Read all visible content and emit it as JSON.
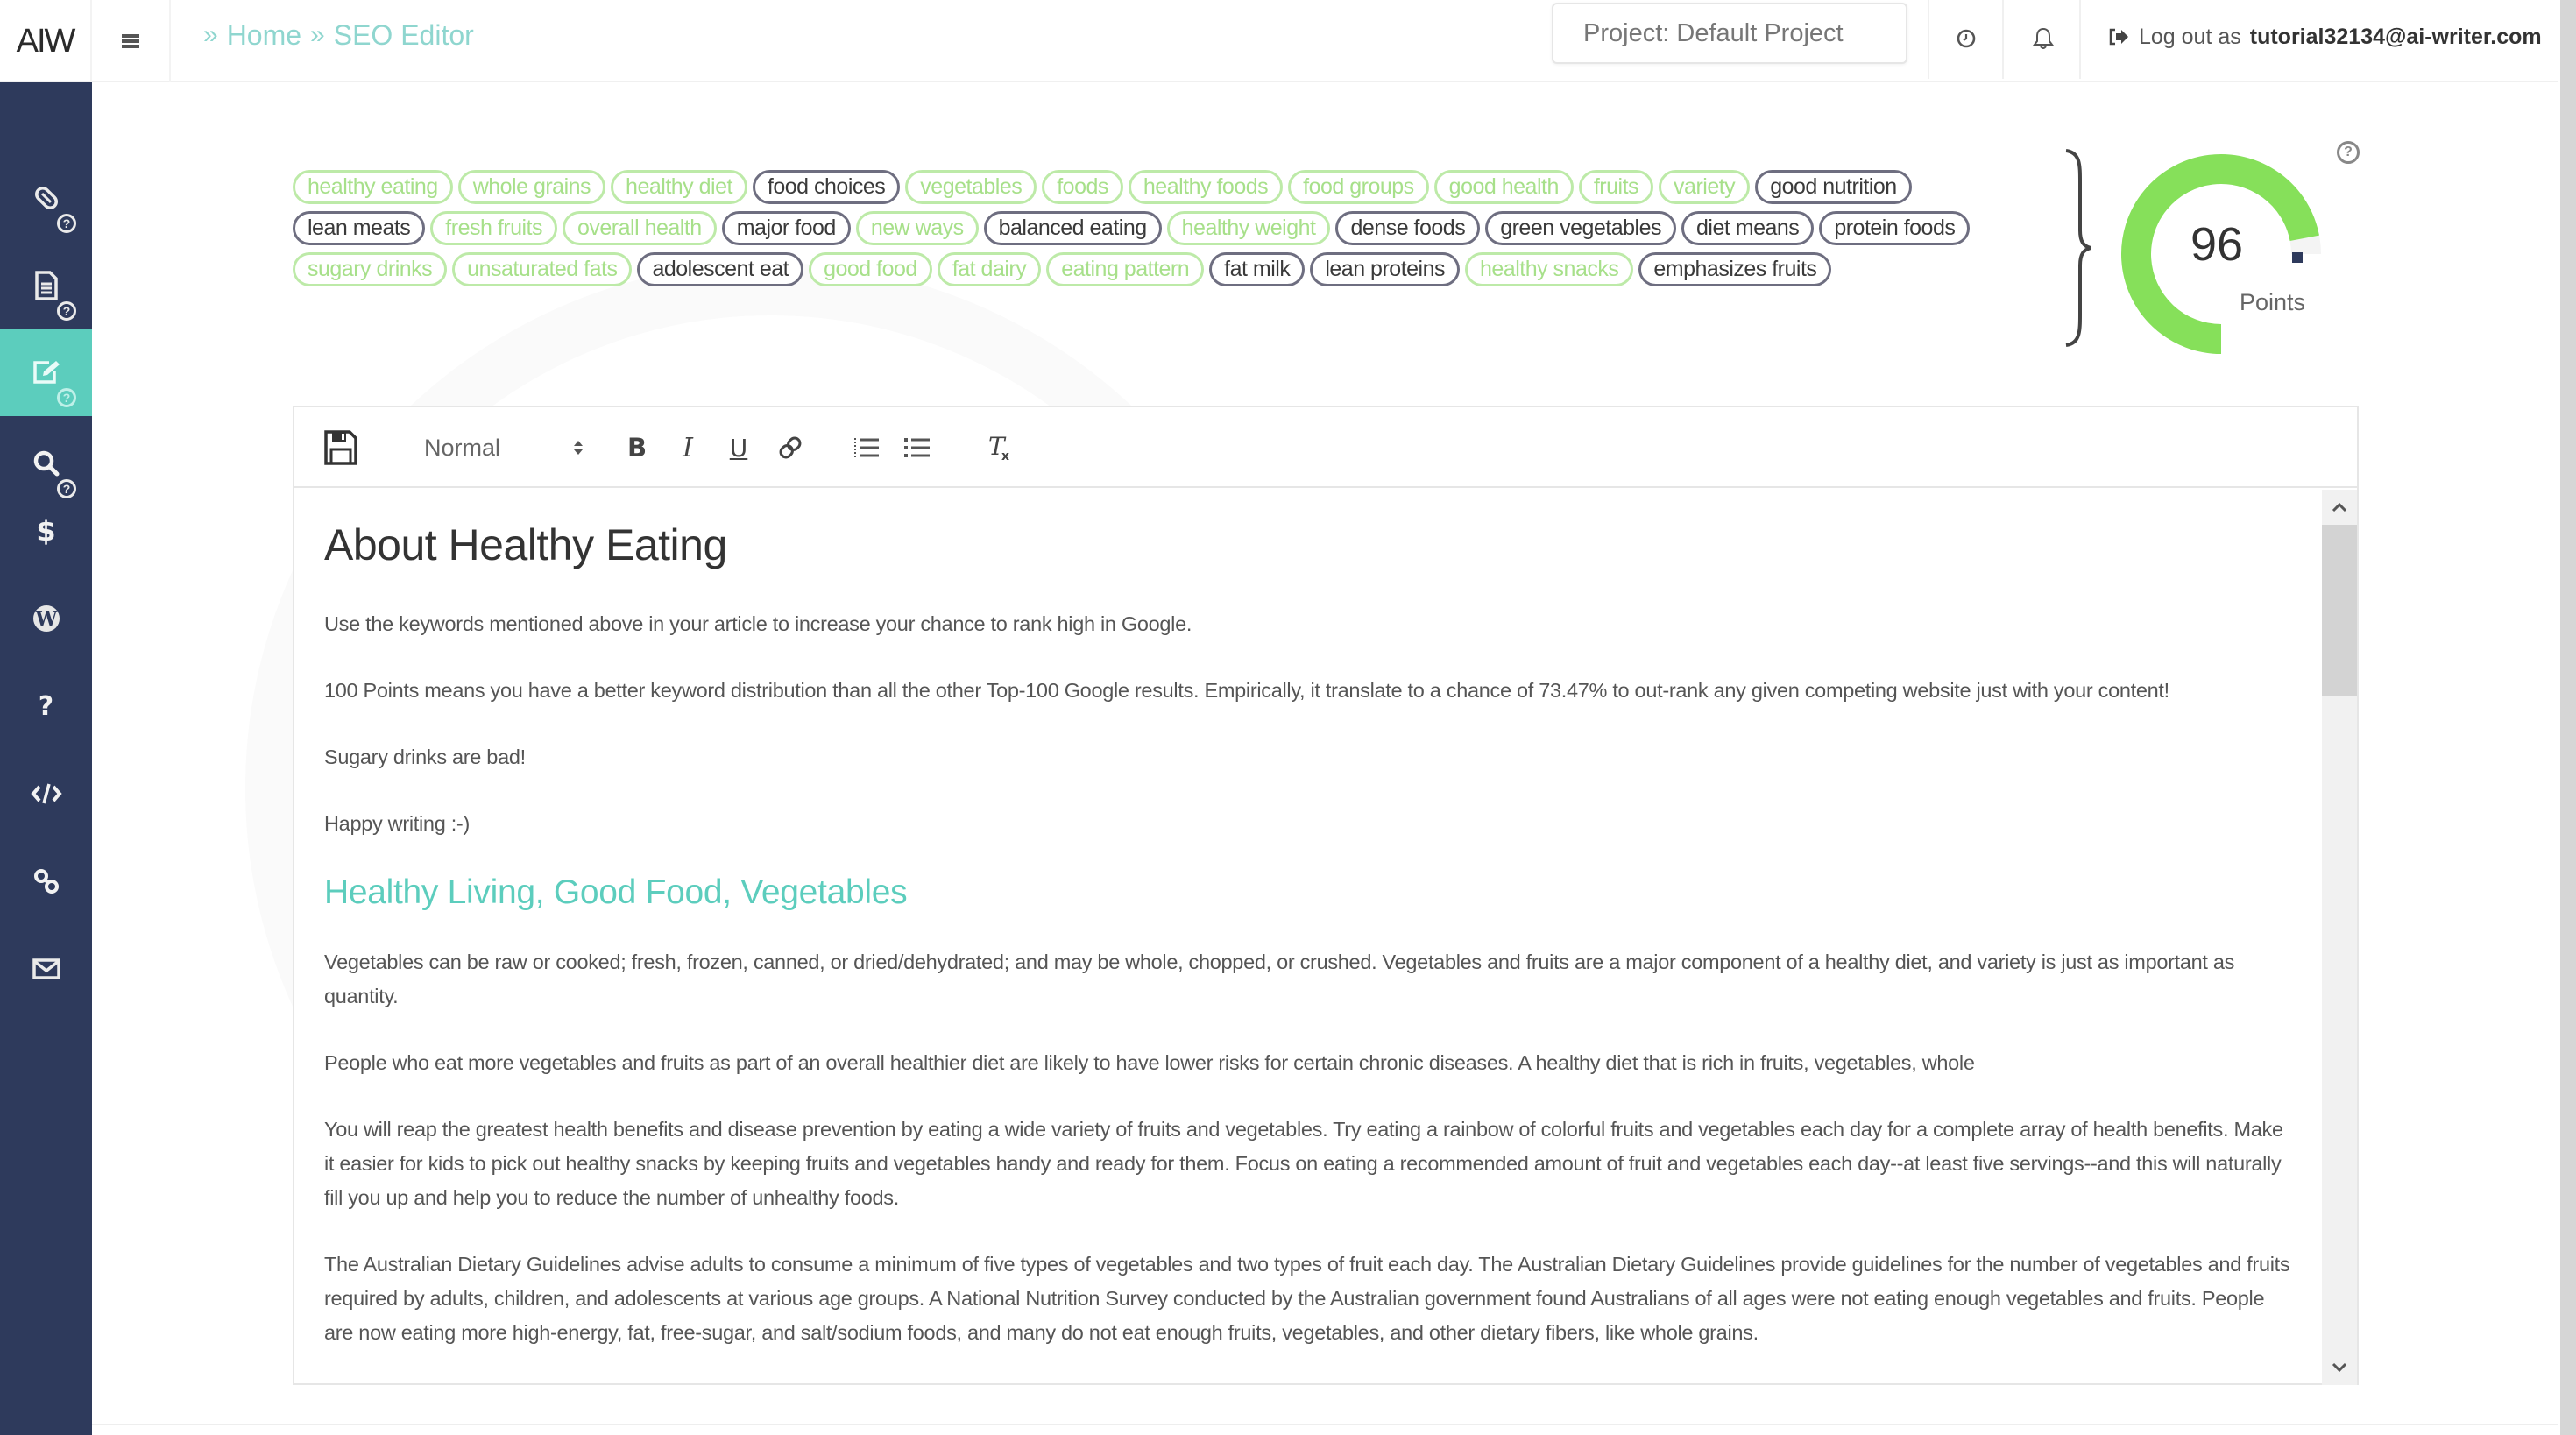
{
  "app": {
    "logo": "AIW",
    "breadcrumb": [
      {
        "label": "Home"
      },
      {
        "label": "SEO Editor"
      }
    ],
    "breadcrumb_separator": "»",
    "project_selector": "Project: Default Project",
    "logout_prefix": "Log out as",
    "user_email": "tutorial32134@ai-writer.com"
  },
  "sidebar": {
    "items": [
      {
        "icon": "paperclip-icon",
        "has_help": true,
        "active": false
      },
      {
        "icon": "document-icon",
        "has_help": true,
        "active": false
      },
      {
        "icon": "edit-icon",
        "has_help": true,
        "active": true
      },
      {
        "icon": "search-icon",
        "has_help": true,
        "active": false
      },
      {
        "icon": "dollar-icon",
        "has_help": false,
        "active": false
      },
      {
        "icon": "wordpress-icon",
        "has_help": false,
        "active": false
      },
      {
        "icon": "question-icon",
        "has_help": false,
        "active": false
      },
      {
        "icon": "code-icon",
        "has_help": false,
        "active": false
      },
      {
        "icon": "link-icon",
        "has_help": false,
        "active": false
      },
      {
        "icon": "envelope-icon",
        "has_help": false,
        "active": false
      }
    ],
    "help_glyph": "?"
  },
  "keywords": [
    {
      "text": "healthy eating",
      "used": false
    },
    {
      "text": "whole grains",
      "used": false
    },
    {
      "text": "healthy diet",
      "used": false
    },
    {
      "text": "food choices",
      "used": true
    },
    {
      "text": "vegetables",
      "used": false
    },
    {
      "text": "foods",
      "used": false
    },
    {
      "text": "healthy foods",
      "used": false
    },
    {
      "text": "food groups",
      "used": false
    },
    {
      "text": "good health",
      "used": false
    },
    {
      "text": "fruits",
      "used": false
    },
    {
      "text": "variety",
      "used": false
    },
    {
      "text": "good nutrition",
      "used": true
    },
    {
      "text": "lean meats",
      "used": true
    },
    {
      "text": "fresh fruits",
      "used": false
    },
    {
      "text": "overall health",
      "used": false
    },
    {
      "text": "major food",
      "used": true
    },
    {
      "text": "new ways",
      "used": false
    },
    {
      "text": "balanced eating",
      "used": true
    },
    {
      "text": "healthy weight",
      "used": false
    },
    {
      "text": "dense foods",
      "used": true
    },
    {
      "text": "green vegetables",
      "used": true
    },
    {
      "text": "diet means",
      "used": true
    },
    {
      "text": "protein foods",
      "used": true
    },
    {
      "text": "sugary drinks",
      "used": false
    },
    {
      "text": "unsaturated fats",
      "used": false
    },
    {
      "text": "adolescent eat",
      "used": true
    },
    {
      "text": "good food",
      "used": false
    },
    {
      "text": "fat dairy",
      "used": false
    },
    {
      "text": "eating pattern",
      "used": false
    },
    {
      "text": "fat milk",
      "used": true
    },
    {
      "text": "lean proteins",
      "used": true
    },
    {
      "text": "healthy snacks",
      "used": false
    },
    {
      "text": "emphasizes fruits",
      "used": true
    }
  ],
  "score": {
    "value": 96,
    "max": 100,
    "label": "Points",
    "help_glyph": "?",
    "color": "#86e05a",
    "marker_color": "#2e3a5c"
  },
  "editor": {
    "toolbar": {
      "format_select": "Normal",
      "buttons": [
        "save",
        "bold",
        "italic",
        "underline",
        "link",
        "ordered-list",
        "bullet-list",
        "clear-format"
      ]
    },
    "content": {
      "title": "About Healthy Eating",
      "intro_paragraphs": [
        "Use the keywords mentioned above in your article to increase your chance to rank high in Google.",
        "100 Points means you have a better keyword distribution than all the other Top-100 Google results. Empirically, it translate to a chance of 73.47% to out-rank any given competing website just with your content!",
        "Sugary drinks are bad!",
        "Happy writing :-)"
      ],
      "subtitle": "Healthy Living, Good Food, Vegetables",
      "body_paragraphs": [
        "Vegetables can be raw or cooked; fresh, frozen, canned, or dried/dehydrated; and may be whole, chopped, or crushed. Vegetables and fruits are a major component of a healthy diet, and variety is just as important as quantity.",
        "People who eat more vegetables and fruits as part of an overall healthier diet are likely to have lower risks for certain chronic diseases. A healthy diet that is rich in fruits, vegetables, whole",
        "You will reap the greatest health benefits and disease prevention by eating a wide variety of fruits and vegetables. Try eating a rainbow of colorful fruits and vegetables each day for a complete array of health benefits. Make it easier for kids to pick out healthy snacks by keeping fruits and vegetables handy and ready for them. Focus on eating a recommended amount of fruit and vegetables each day--at least five servings--and this will naturally fill you up and help you to reduce the number of unhealthy foods.",
        "The Australian Dietary Guidelines advise adults to consume a minimum of five types of vegetables and two types of fruit each day. The Australian Dietary Guidelines provide guidelines for the number of vegetables and fruits required by adults, children, and adolescents at various age groups. A National Nutrition Survey conducted by the Australian government found Australians of all ages were not eating enough vegetables and fruits. People are now eating more high-energy, fat, free-sugar, and salt/sodium foods, and many do not eat enough fruits, vegetables, and other dietary fibers, like whole grains."
      ]
    }
  },
  "colors": {
    "sidebar_bg": "#2e3a5c",
    "accent_teal": "#5ccdbd",
    "keyword_unused": "#a7e08a",
    "keyword_used": "#3a3a3a"
  }
}
